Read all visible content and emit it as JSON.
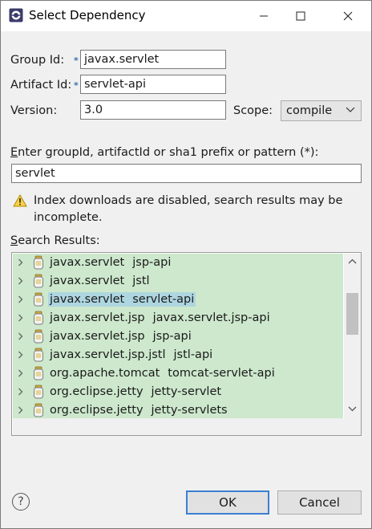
{
  "window": {
    "title": "Select Dependency"
  },
  "form": {
    "group_id_label": "Group Id:",
    "group_id_value": "javax.servlet",
    "artifact_id_label": "Artifact Id:",
    "artifact_id_value": "servlet-api",
    "version_label": "Version:",
    "version_value": "3.0",
    "scope_label": "Scope:",
    "scope_value": "compile",
    "required_marker": "*"
  },
  "search": {
    "prompt_label": "Enter groupId, artifactId or sha1 prefix or pattern (*):",
    "prompt_mnemonic": "E",
    "prompt_rest": "nter groupId, artifactId or sha1 prefix or pattern (*):",
    "query": "servlet",
    "warning_line1": "Index downloads are disabled, search results may be",
    "warning_line2": "incomplete.",
    "results_label": "Search Results:",
    "results_mnemonic": "S",
    "results_rest": "earch Results:"
  },
  "results": [
    {
      "group": "javax.servlet",
      "artifact": "jsp-api",
      "selected": false
    },
    {
      "group": "javax.servlet",
      "artifact": "jstl",
      "selected": false
    },
    {
      "group": "javax.servlet",
      "artifact": "servlet-api",
      "selected": true
    },
    {
      "group": "javax.servlet.jsp",
      "artifact": "javax.servlet.jsp-api",
      "selected": false
    },
    {
      "group": "javax.servlet.jsp",
      "artifact": "jsp-api",
      "selected": false
    },
    {
      "group": "javax.servlet.jsp.jstl",
      "artifact": "jstl-api",
      "selected": false
    },
    {
      "group": "org.apache.tomcat",
      "artifact": "tomcat-servlet-api",
      "selected": false
    },
    {
      "group": "org.eclipse.jetty",
      "artifact": "jetty-servlet",
      "selected": false
    },
    {
      "group": "org.eclipse.jetty",
      "artifact": "jetty-servlets",
      "selected": false
    }
  ],
  "buttons": {
    "ok": "OK",
    "cancel": "Cancel",
    "help": "?"
  },
  "colors": {
    "result_background": "#cde8cd",
    "selection": "#aed6e0",
    "required_marker": "#3a6fb0",
    "default_button_border": "#3c7fd3"
  },
  "icons": {
    "app": "eclipse-icon",
    "minimize": "minimize-icon",
    "maximize": "maximize-icon",
    "close": "close-icon",
    "warning": "warning-icon",
    "jar": "jar-icon",
    "expand": "chevron-right-icon"
  }
}
